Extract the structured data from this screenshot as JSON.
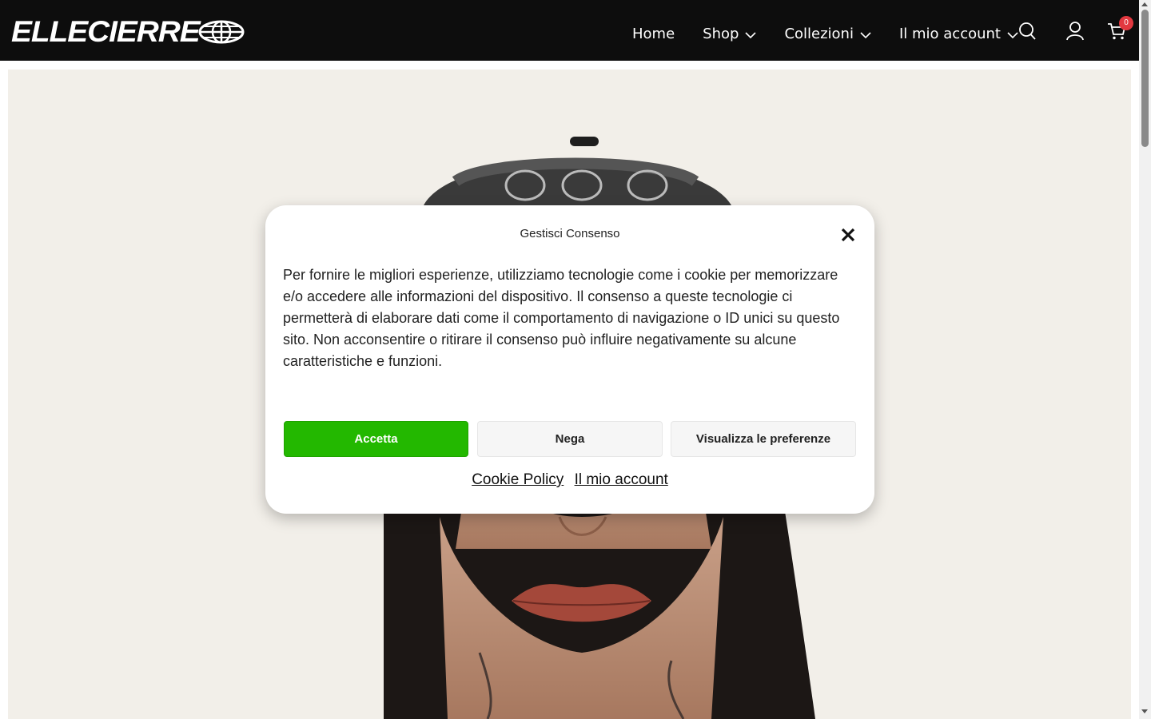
{
  "brand": {
    "logo_text": "ELLECIERRE"
  },
  "nav": {
    "items": [
      {
        "label": "Home",
        "has_dropdown": false
      },
      {
        "label": "Shop",
        "has_dropdown": true
      },
      {
        "label": "Collezioni",
        "has_dropdown": true
      },
      {
        "label": "Il mio account",
        "has_dropdown": true
      }
    ]
  },
  "header_icons": {
    "search": "search-icon",
    "account": "user-icon",
    "cart": "cart-icon",
    "cart_count": "0"
  },
  "colors": {
    "header_bg": "#0d0d0d",
    "accept": "#23b800",
    "badge": "#e2383f"
  },
  "consent": {
    "title": "Gestisci Consenso",
    "body": "Per fornire le migliori esperienze, utilizziamo tecnologie come i cookie per memorizzare e/o accedere alle informazioni del dispositivo. Il consenso a queste tecnologie ci permetterà di elaborare dati come il comportamento di navigazione o ID unici su questo sito. Non acconsentire o ritirare il consenso può influire negativamente su alcune caratteristiche e funzioni.",
    "buttons": {
      "accept": "Accetta",
      "deny": "Nega",
      "preferences": "Visualizza le preferenze"
    },
    "links": {
      "cookie_policy": "Cookie Policy",
      "account": "Il mio account"
    }
  }
}
